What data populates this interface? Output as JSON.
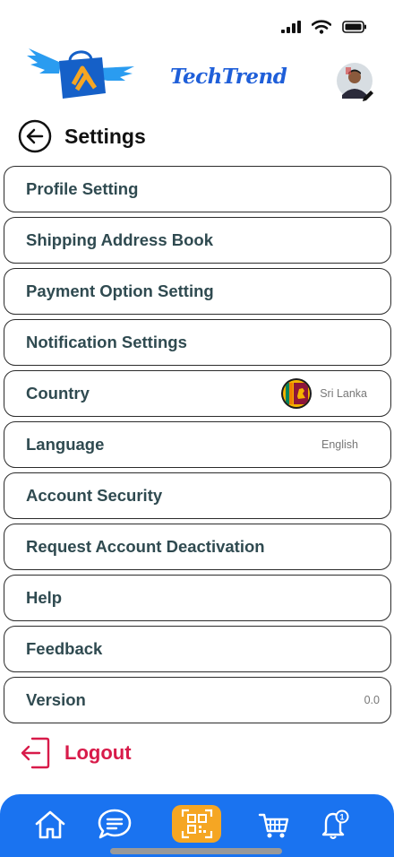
{
  "app": {
    "brand_name": "TechTrend"
  },
  "page": {
    "title": "Settings"
  },
  "settings": {
    "items": [
      {
        "label": "Profile Setting",
        "value": ""
      },
      {
        "label": "Shipping Address Book",
        "value": ""
      },
      {
        "label": "Payment Option Setting",
        "value": ""
      },
      {
        "label": "Notification Settings",
        "value": ""
      },
      {
        "label": "Country",
        "value": "Sri Lanka",
        "icon": "sri-lanka-flag-icon"
      },
      {
        "label": "Language",
        "value": "English"
      },
      {
        "label": "Account Security",
        "value": ""
      },
      {
        "label": "Request Account Deactivation",
        "value": ""
      },
      {
        "label": "Help",
        "value": ""
      },
      {
        "label": "Feedback",
        "value": ""
      },
      {
        "label": "Version",
        "value": "0.0"
      }
    ]
  },
  "logout": {
    "label": "Logout",
    "color": "#d81b4a"
  },
  "nav": {
    "items": [
      "home-icon",
      "chat-icon",
      "qr-scan-icon",
      "cart-icon",
      "notification-bell-icon"
    ],
    "notification_count": "1",
    "accent": "#1a73f0",
    "scan_color": "#f5a623"
  }
}
